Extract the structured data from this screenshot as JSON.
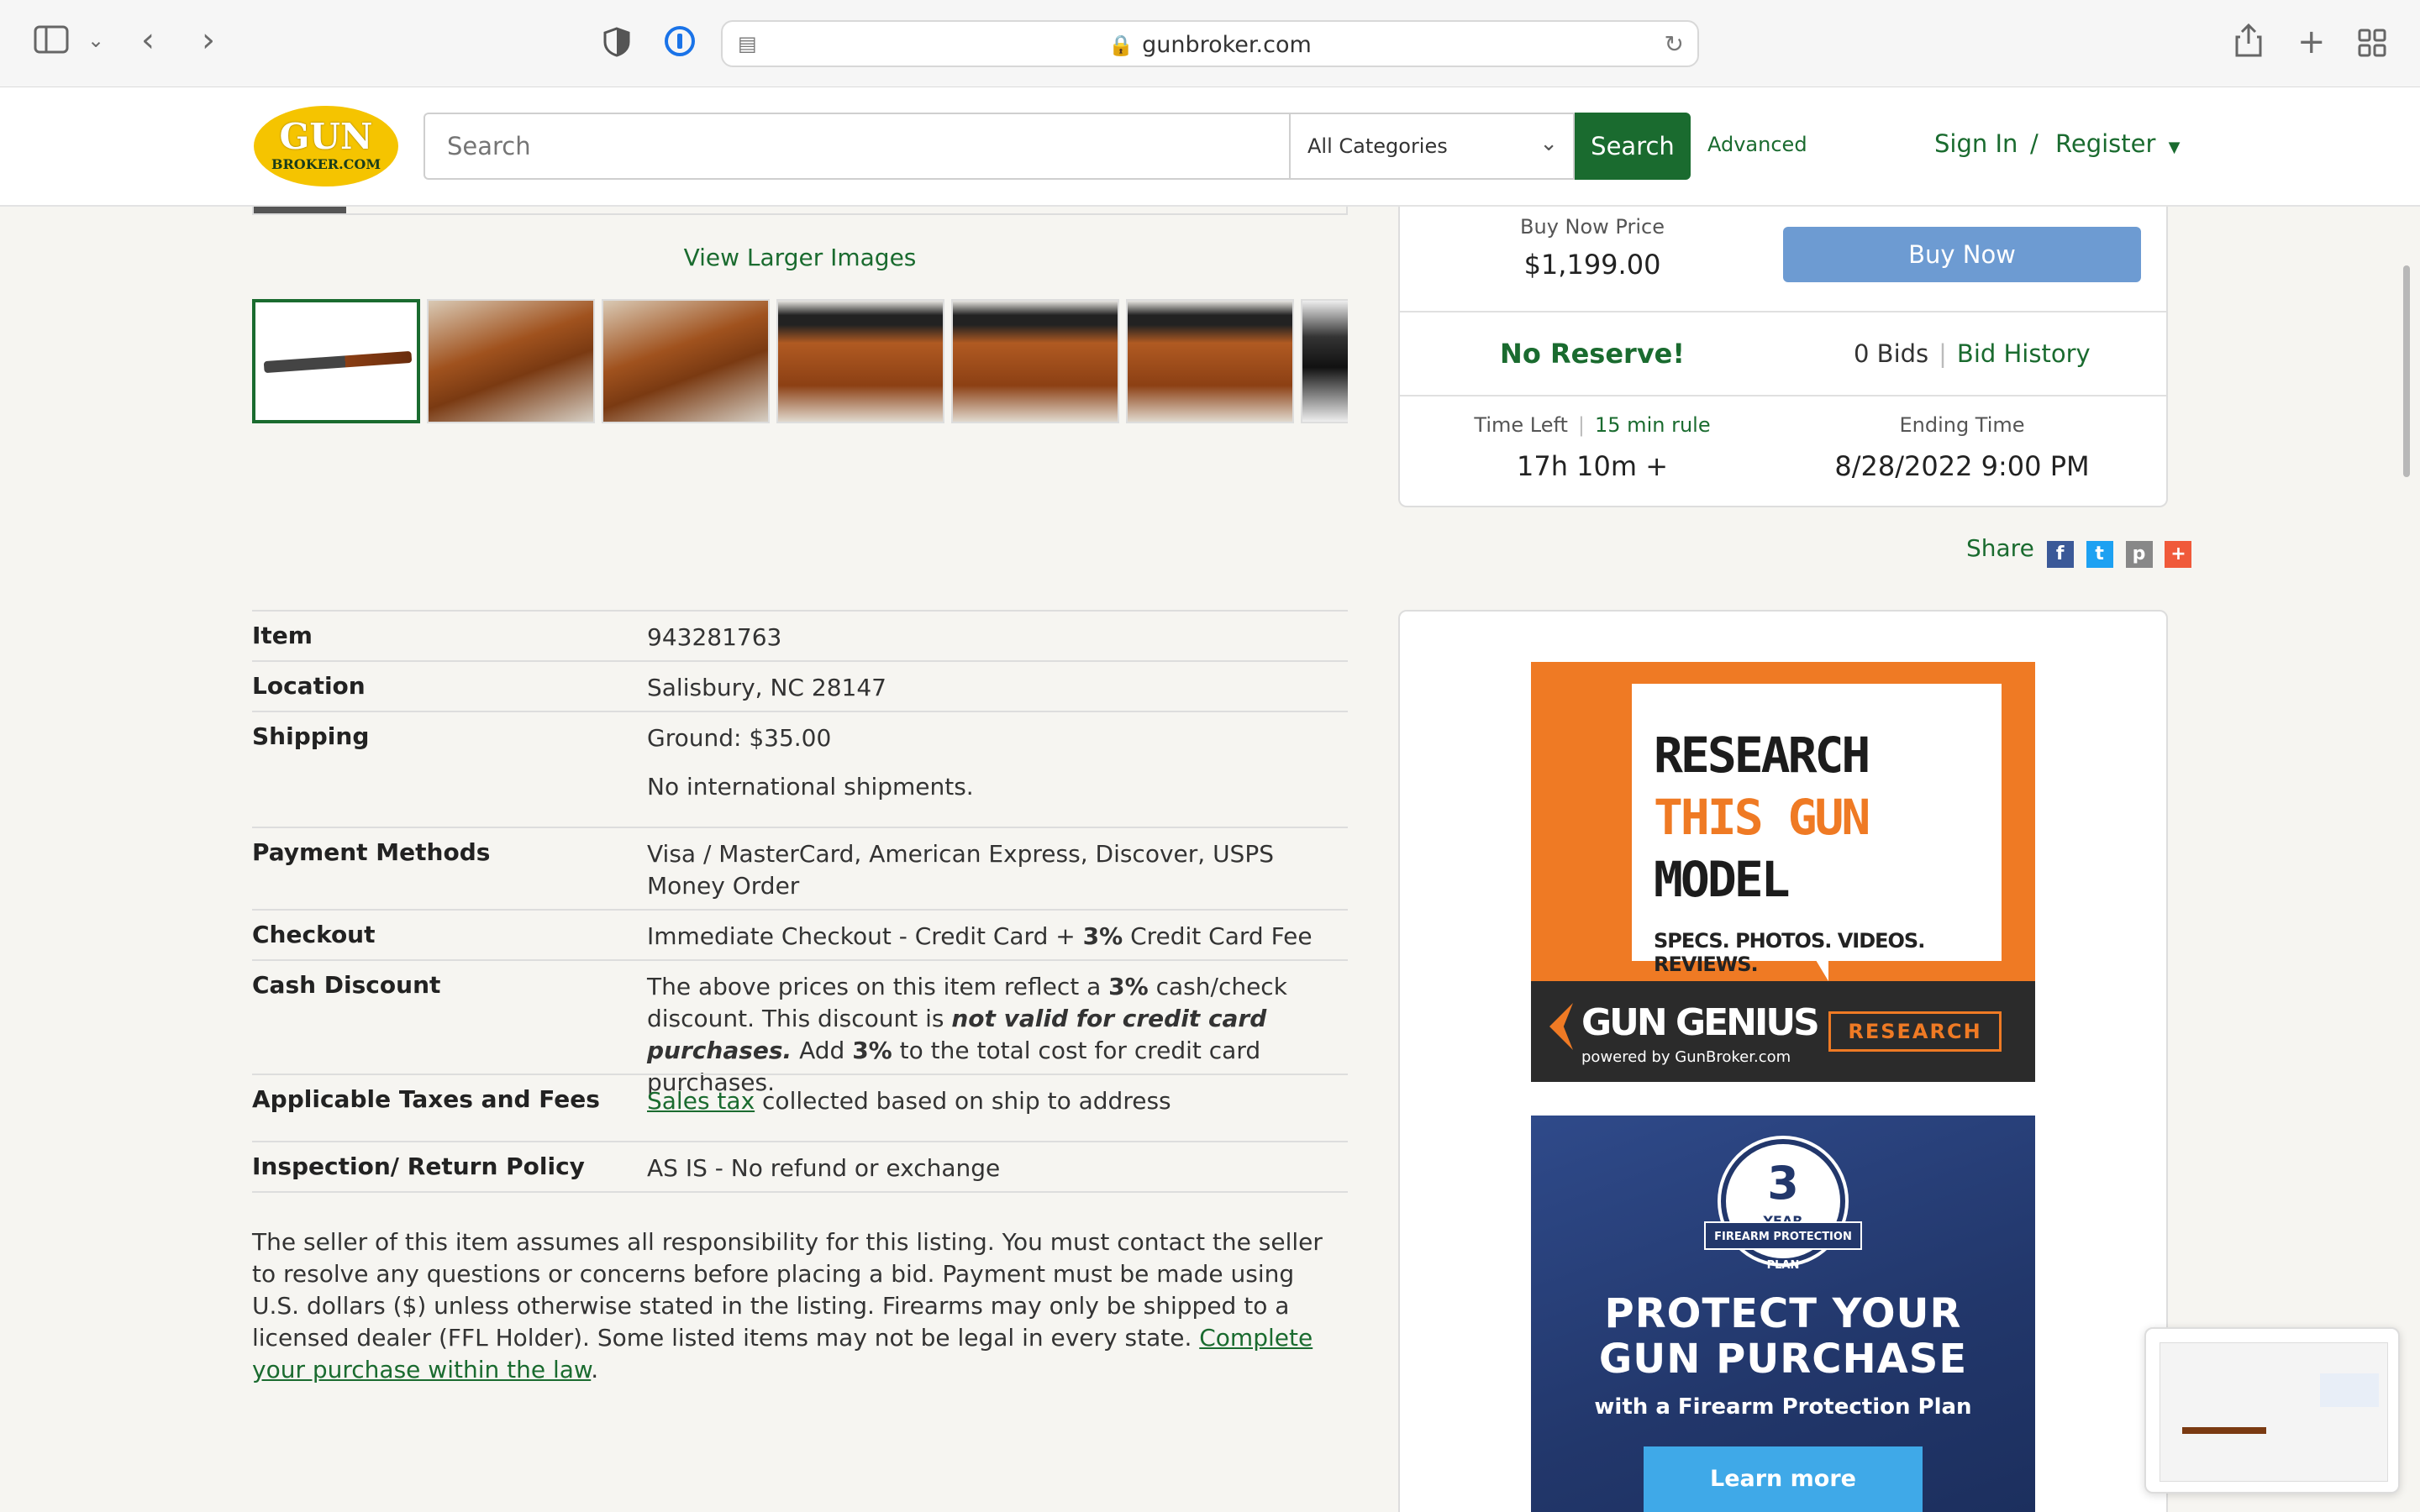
{
  "browser": {
    "url": "gunbroker.com"
  },
  "header": {
    "logo_line1": "GUN",
    "logo_line2": "BROKER.COM",
    "search_placeholder": "Search",
    "category": "All Categories",
    "search_button": "Search",
    "advanced": "Advanced",
    "sign_in": "Sign In",
    "slash": "/",
    "register": "Register"
  },
  "gallery": {
    "view_larger": "View Larger Images",
    "thumb_count": 7
  },
  "buybox": {
    "buy_now_price_label": "Buy Now Price",
    "buy_now_price": "$1,199.00",
    "buy_now_button": "Buy Now",
    "no_reserve": "No Reserve!",
    "bids": "0 Bids",
    "bid_history": "Bid History",
    "time_left_label": "Time Left",
    "rule_link": "15 min rule",
    "time_left": "17h 10m +",
    "ending_label": "Ending Time",
    "ending_time": "8/28/2022 9:00 PM"
  },
  "share": {
    "label": "Share",
    "facebook": "f",
    "twitter": "t",
    "print": "p",
    "more": "+"
  },
  "details": {
    "item": {
      "k": "Item",
      "v": "943281763"
    },
    "location": {
      "k": "Location",
      "v": "Salisbury, NC 28147"
    },
    "shipping": {
      "k": "Shipping",
      "v": "Ground: $35.00",
      "v2": "No international shipments."
    },
    "payment": {
      "k": "Payment Methods",
      "v": "Visa / MasterCard, American Express, Discover, USPS Money Order"
    },
    "checkout": {
      "k": "Checkout",
      "v_a": "Immediate Checkout - Credit Card + ",
      "v_b": "3%",
      "v_c": " Credit Card Fee"
    },
    "cash": {
      "k": "Cash Discount",
      "v_a": "The above prices on this item reflect a ",
      "v_b": "3%",
      "v_c": " cash/check discount. This discount is ",
      "v_d": "not valid for credit card purchases.",
      "v_e": " Add ",
      "v_f": "3%",
      "v_g": " to the total cost for credit card purchases."
    },
    "taxes": {
      "k": "Applicable Taxes and Fees",
      "link": "Sales tax",
      "v": " collected based on ship to address"
    },
    "inspection": {
      "k": "Inspection/ Return Policy",
      "v": "AS IS - No refund or exchange"
    }
  },
  "disclaimer": {
    "text": "The seller of this item assumes all responsibility for this listing. You must contact the seller to resolve any questions or concerns before placing a bid. Payment must be made using U.S. dollars ($) unless otherwise stated in the listing. Firearms may only be shipped to a licensed dealer (FFL Holder). Some listed items may not be legal in every state. ",
    "link": "Complete your purchase within the law",
    "end": "."
  },
  "ad1": {
    "line1": "RESEARCH",
    "line2": "THIS GUN",
    "line3": "MODEL",
    "tagline": "SPECS. PHOTOS. VIDEOS. REVIEWS.",
    "brand": "GUN GENIUS",
    "powered": "powered by GunBroker.com",
    "button": "RESEARCH",
    "accent": "#ef7a24"
  },
  "ad2": {
    "badge_num": "3",
    "badge_year": "YEAR",
    "badge_ribbon": "FIREARM PROTECTION PLAN",
    "headline1": "PROTECT YOUR",
    "headline2": "GUN PURCHASE",
    "sub": "with a Firearm Protection Plan",
    "button": "Learn more"
  },
  "colors": {
    "brand_green": "#1a6b2f",
    "buy_now_blue": "#6d9bd2",
    "logo_yellow": "#f5c400"
  }
}
